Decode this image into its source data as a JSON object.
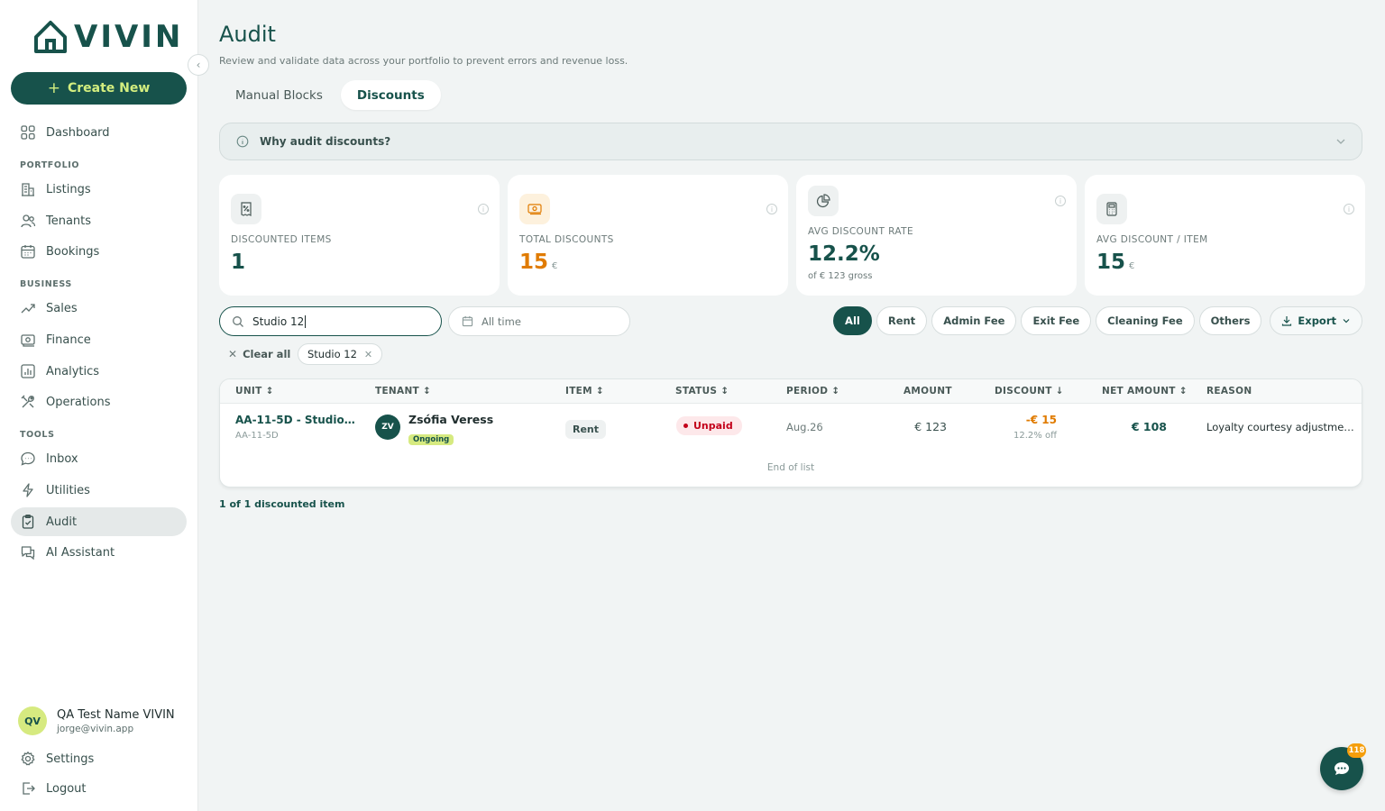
{
  "brand": {
    "name": "VIVIN"
  },
  "sidebar": {
    "create_label": "Create New",
    "dashboard": "Dashboard",
    "portfolio_label": "PORTFOLIO",
    "listings": "Listings",
    "tenants": "Tenants",
    "bookings": "Bookings",
    "business_label": "BUSINESS",
    "sales": "Sales",
    "finance": "Finance",
    "analytics": "Analytics",
    "operations": "Operations",
    "tools_label": "TOOLS",
    "inbox": "Inbox",
    "utilities": "Utilities",
    "audit": "Audit",
    "ai_assistant": "AI Assistant",
    "settings": "Settings",
    "logout": "Logout"
  },
  "user": {
    "initials": "QV",
    "name": "QA Test Name VIVIN",
    "email": "jorge@vivin.app"
  },
  "page": {
    "title": "Audit",
    "subtitle": "Review and validate data across your portfolio to prevent errors and revenue loss.",
    "tabs": [
      "Manual Blocks",
      "Discounts"
    ],
    "active_tab": "Discounts",
    "why_label": "Why audit discounts?"
  },
  "kpis": [
    {
      "label": "DISCOUNTED ITEMS",
      "value": "1",
      "unit": ""
    },
    {
      "label": "TOTAL DISCOUNTS",
      "value": "15",
      "unit": "€"
    },
    {
      "label": "AVG DISCOUNT RATE",
      "value": "12.2%",
      "unit": "",
      "sub": "of € 123 gross"
    },
    {
      "label": "AVG DISCOUNT / ITEM",
      "value": "15",
      "unit": "€"
    }
  ],
  "search": {
    "value": "Studio 12",
    "placeholder": "Search"
  },
  "date_filter": {
    "value": "All time"
  },
  "filters": [
    "All",
    "Rent",
    "Admin Fee",
    "Exit Fee",
    "Cleaning Fee",
    "Others"
  ],
  "active_filter": "All",
  "export_label": "Export",
  "active_tags": {
    "clear_all": "Clear all",
    "tag": "Studio 12"
  },
  "table": {
    "columns": [
      "UNIT",
      "TENANT",
      "ITEM",
      "STATUS",
      "PERIOD",
      "AMOUNT",
      "DISCOUNT",
      "NET AMOUNT",
      "REASON"
    ],
    "rows": [
      {
        "unit_name": "AA-11-5D - Studio…",
        "unit_code": "AA-11-5D",
        "tenant_initials": "ZV",
        "tenant_name": "Zsófia Veress",
        "tenant_status": "Ongoing",
        "item": "Rent",
        "status": "Unpaid",
        "period": "Aug.26",
        "amount": "€ 123",
        "discount": "-€ 15",
        "discount_pct": "12.2% off",
        "net_amount": "€ 108",
        "reason": "Loyalty courtesy adjustme…"
      }
    ],
    "end_of_list": "End of list"
  },
  "count_text": "1 of 1 discounted item",
  "chat": {
    "badge": "118"
  },
  "colors": {
    "primary": "#17524b",
    "accent": "#d6ea80",
    "orange": "#e07b00",
    "danger": "#c3001a"
  }
}
